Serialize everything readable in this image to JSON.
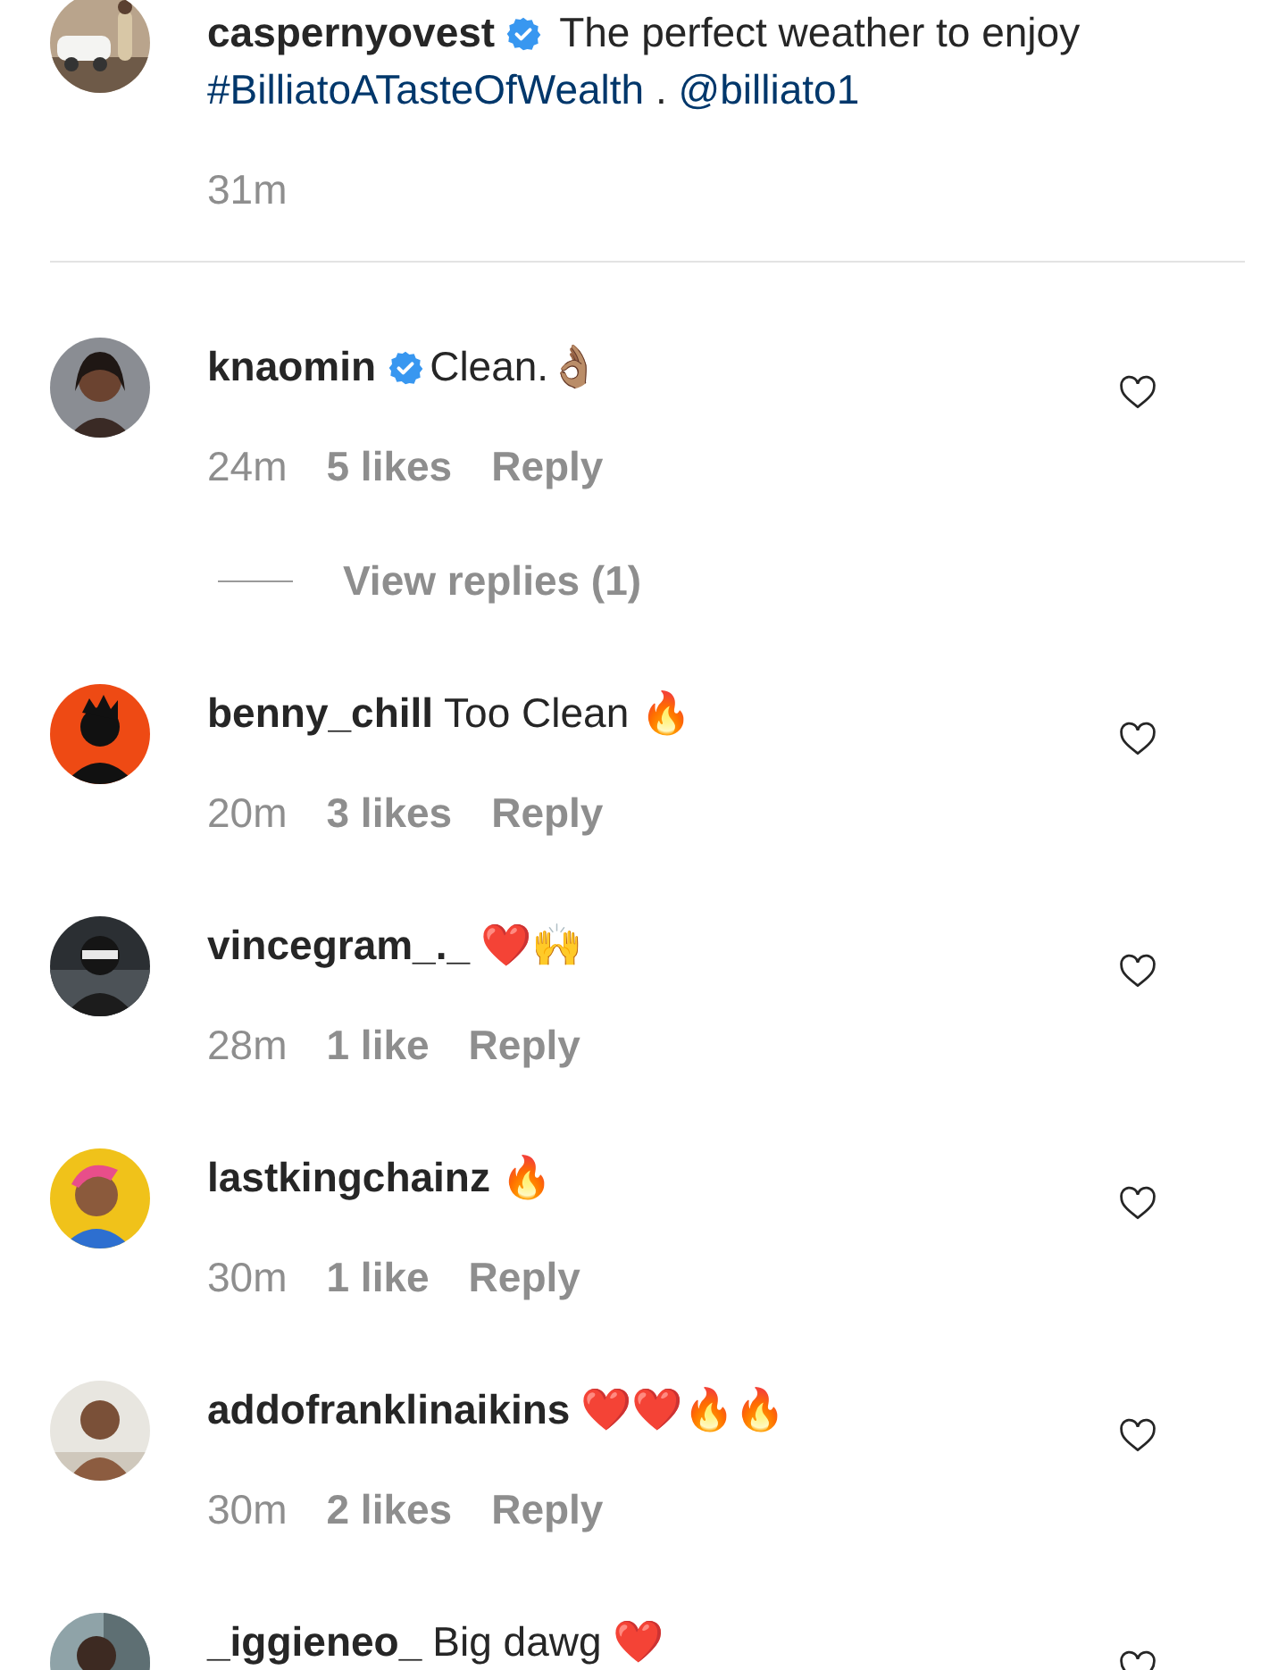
{
  "caption": {
    "username": "caspernyovest",
    "verified": true,
    "parts": [
      {
        "kind": "text",
        "text": " The perfect weather to enjoy "
      },
      {
        "kind": "hashtag",
        "text": "#BilliatoATasteOfWealth"
      },
      {
        "kind": "text",
        "text": " . "
      },
      {
        "kind": "mention",
        "text": "@billiato1"
      }
    ],
    "time": "31m"
  },
  "comments": [
    {
      "username": "knaomin",
      "verified": true,
      "text": "Clean.👌🏽",
      "time": "24m",
      "likes": "5 likes",
      "reply": "Reply",
      "liked": false,
      "view_replies": "View replies (1)"
    },
    {
      "username": "benny_chill",
      "text": "Too Clean 🔥",
      "time": "20m",
      "likes": "3 likes",
      "reply": "Reply",
      "liked": false
    },
    {
      "username": "vincegram_._",
      "text": "❤️🙌",
      "time": "28m",
      "likes": "1 like",
      "reply": "Reply",
      "liked": false
    },
    {
      "username": "lastkingchainz",
      "text": "🔥",
      "time": "30m",
      "likes": "1 like",
      "reply": "Reply",
      "liked": false
    },
    {
      "username": "addofranklinaikins",
      "text": "❤️❤️🔥🔥",
      "time": "30m",
      "likes": "2 likes",
      "reply": "Reply",
      "liked": false
    },
    {
      "username": "_iggieneo_",
      "text": "Big dawg ❤️",
      "liked": false
    }
  ]
}
